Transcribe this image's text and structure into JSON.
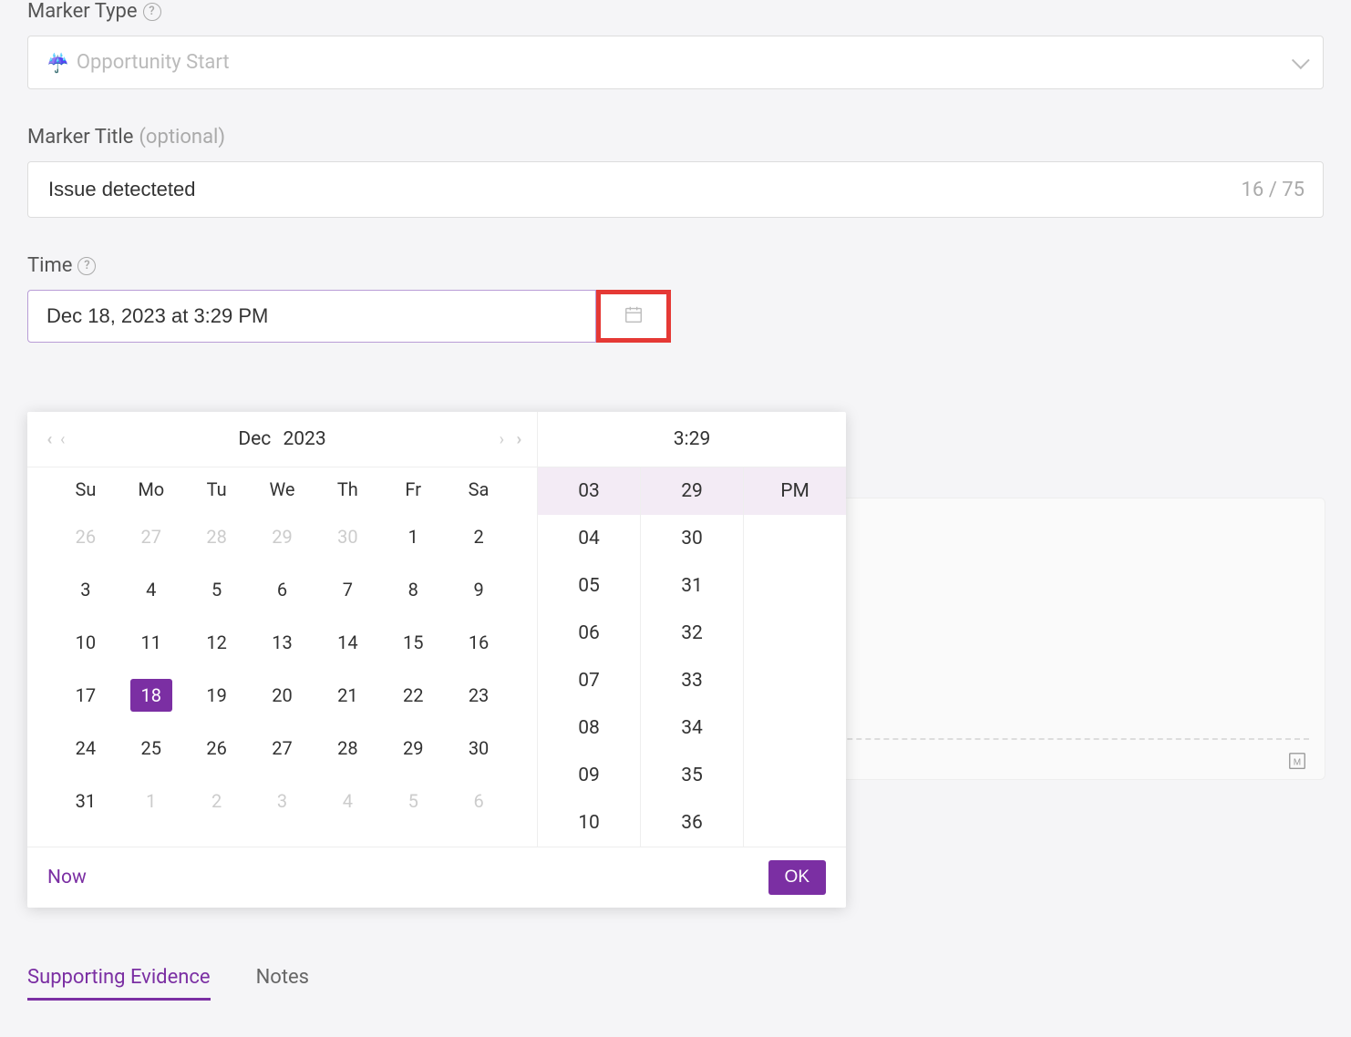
{
  "marker_type": {
    "label": "Marker Type",
    "emoji": "☔",
    "selected": "Opportunity Start"
  },
  "marker_title": {
    "label": "Marker Title",
    "optional": "(optional)",
    "value": "Issue detecteted",
    "count": "16 / 75"
  },
  "time": {
    "label": "Time",
    "value": "Dec 18, 2023 at 3:29 PM"
  },
  "picker": {
    "month": "Dec",
    "year": "2023",
    "time_display": "3:29",
    "dow": [
      "Su",
      "Mo",
      "Tu",
      "We",
      "Th",
      "Fr",
      "Sa"
    ],
    "weeks": [
      [
        {
          "d": "26",
          "o": true
        },
        {
          "d": "27",
          "o": true
        },
        {
          "d": "28",
          "o": true
        },
        {
          "d": "29",
          "o": true
        },
        {
          "d": "30",
          "o": true
        },
        {
          "d": "1"
        },
        {
          "d": "2"
        }
      ],
      [
        {
          "d": "3"
        },
        {
          "d": "4"
        },
        {
          "d": "5"
        },
        {
          "d": "6"
        },
        {
          "d": "7"
        },
        {
          "d": "8"
        },
        {
          "d": "9"
        }
      ],
      [
        {
          "d": "10"
        },
        {
          "d": "11"
        },
        {
          "d": "12"
        },
        {
          "d": "13"
        },
        {
          "d": "14"
        },
        {
          "d": "15"
        },
        {
          "d": "16"
        }
      ],
      [
        {
          "d": "17"
        },
        {
          "d": "18",
          "sel": true
        },
        {
          "d": "19"
        },
        {
          "d": "20"
        },
        {
          "d": "21"
        },
        {
          "d": "22"
        },
        {
          "d": "23"
        }
      ],
      [
        {
          "d": "24"
        },
        {
          "d": "25"
        },
        {
          "d": "26"
        },
        {
          "d": "27"
        },
        {
          "d": "28"
        },
        {
          "d": "29"
        },
        {
          "d": "30"
        }
      ],
      [
        {
          "d": "31"
        },
        {
          "d": "1",
          "o": true
        },
        {
          "d": "2",
          "o": true
        },
        {
          "d": "3",
          "o": true
        },
        {
          "d": "4",
          "o": true
        },
        {
          "d": "5",
          "o": true
        },
        {
          "d": "6",
          "o": true
        }
      ]
    ],
    "hours": [
      "03",
      "04",
      "05",
      "06",
      "07",
      "08",
      "09",
      "10"
    ],
    "minutes": [
      "29",
      "30",
      "31",
      "32",
      "33",
      "34",
      "35",
      "36"
    ],
    "ampm": [
      "PM"
    ],
    "selected_hour": "03",
    "selected_minute": "29",
    "selected_ampm": "PM",
    "now_label": "Now",
    "ok_label": "OK"
  },
  "tabs": {
    "active": "Supporting Evidence",
    "other": "Notes"
  }
}
